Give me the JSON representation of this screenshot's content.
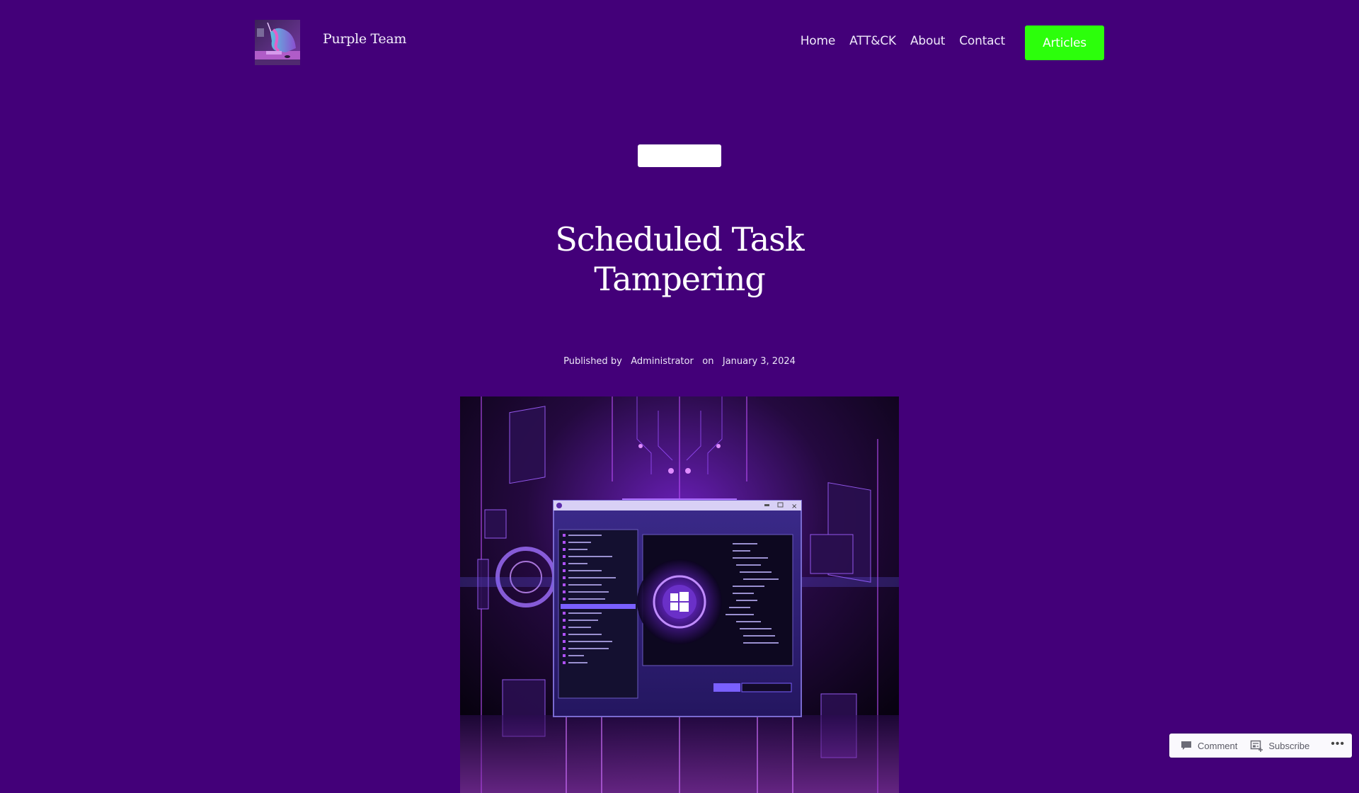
{
  "site": {
    "title": "Purple Team",
    "logo_alt": "unicorn-at-keyboard logo"
  },
  "nav": {
    "items": [
      {
        "label": "Home"
      },
      {
        "label": "ATT&CK"
      },
      {
        "label": "About"
      },
      {
        "label": "Contact"
      }
    ],
    "cta_label": "Articles"
  },
  "colors": {
    "background": "#430079",
    "cta": "#2cff0b",
    "text": "#ffffff"
  },
  "post": {
    "category": "",
    "title": "Scheduled Task Tampering",
    "byline_prefix": "Published by",
    "author": "Administrator",
    "byline_on": "on",
    "date": "January 3, 2024",
    "featured_image_alt": "Purple cyberpunk illustration of a Windows application window with task list, surrounded by glowing circuitry"
  },
  "action_bar": {
    "comment_label": "Comment",
    "subscribe_label": "Subscribe",
    "more_label": "•••"
  }
}
